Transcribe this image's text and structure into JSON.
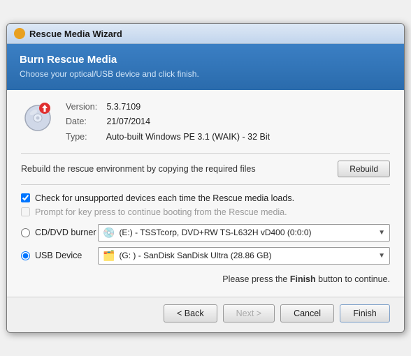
{
  "window": {
    "title": "Rescue Media Wizard"
  },
  "header": {
    "title": "Burn Rescue Media",
    "subtitle": "Choose your optical/USB device and click finish."
  },
  "version_info": {
    "version_label": "Version:",
    "version_value": "5.3.7109",
    "date_label": "Date:",
    "date_value": "21/07/2014",
    "type_label": "Type:",
    "type_value": "Auto-built Windows PE 3.1 (WAIK) - 32 Bit"
  },
  "rebuild": {
    "text": "Rebuild the rescue environment by copying the required files",
    "button_label": "Rebuild"
  },
  "options": {
    "checkbox1_label": "Check for unsupported devices each time the Rescue media loads.",
    "checkbox1_checked": true,
    "checkbox2_label": "Prompt for key press to continue booting from the Rescue media.",
    "checkbox2_checked": false,
    "checkbox2_disabled": true
  },
  "devices": {
    "cd_label": "CD/DVD burner",
    "cd_value": "(E:) - TSSTcorp, DVD+RW TS-L632H vD400 (0:0:0)",
    "usb_label": "USB Device",
    "usb_value": "(G: ) - SanDisk SanDisk Ultra (28.86 GB)"
  },
  "finish_hint": {
    "text_before": "Please press the ",
    "bold_word": "Finish",
    "text_after": " button to continue."
  },
  "footer": {
    "back_label": "< Back",
    "next_label": "Next >",
    "cancel_label": "Cancel",
    "finish_label": "Finish"
  }
}
